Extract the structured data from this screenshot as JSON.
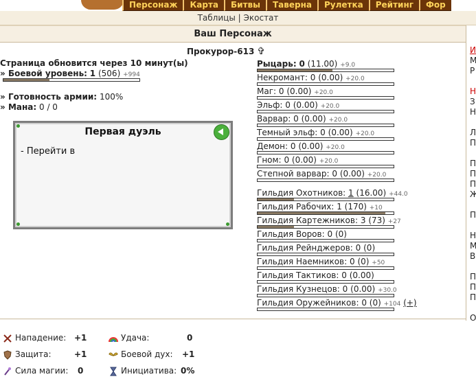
{
  "nav": {
    "tabs": [
      {
        "label": "Персонаж"
      },
      {
        "label": "Карта"
      },
      {
        "label": "Битвы"
      },
      {
        "label": "Таверна"
      },
      {
        "label": "Рулетка"
      },
      {
        "label": "Рейтинг"
      },
      {
        "label": "Фор"
      }
    ],
    "sublinks": {
      "tables": "Таблицы",
      "sep": "|",
      "ecostat": "Экостат"
    }
  },
  "section_title": "Ваш Персонаж",
  "character": {
    "name": "Прокурор-613",
    "cross": "✞",
    "refresh_notice": "Страница обновится через 10 минут(ы)",
    "combat_level_label": "Боевой уровень:",
    "combat_level_value": "1",
    "combat_level_extra": "(506)",
    "combat_level_plus": "+994",
    "combat_level_progress": 0.34,
    "army_ready_label": "Готовность армии:",
    "army_ready_value": "100%",
    "mana_label": "Мана:",
    "mana_value": "0 / 0"
  },
  "duel": {
    "title": "Первая дуэль",
    "text": "- Перейти в"
  },
  "factions": [
    {
      "label": "Рыцарь:",
      "value": "0",
      "extra": "(11.00)",
      "plus": "+9.0",
      "bold": true,
      "progress": 0.55
    },
    {
      "label": "Некромант:",
      "value": "0",
      "extra": "(0.00)",
      "plus": "+20.0",
      "progress": 0
    },
    {
      "label": "Маг:",
      "value": "0",
      "extra": "(0.00)",
      "plus": "+20.0",
      "progress": 0
    },
    {
      "label": "Эльф:",
      "value": "0",
      "extra": "(0.00)",
      "plus": "+20.0",
      "progress": 0
    },
    {
      "label": "Варвар:",
      "value": "0",
      "extra": "(0.00)",
      "plus": "+20.0",
      "progress": 0
    },
    {
      "label": "Темный эльф:",
      "value": "0",
      "extra": "(0.00)",
      "plus": "+20.0",
      "progress": 0
    },
    {
      "label": "Демон:",
      "value": "0",
      "extra": "(0.00)",
      "plus": "+20.0",
      "progress": 0
    },
    {
      "label": "Гном:",
      "value": "0",
      "extra": "(0.00)",
      "plus": "+20.0",
      "progress": 0
    },
    {
      "label": "Степной варвар:",
      "value": "0",
      "extra": "(0.00)",
      "plus": "+20.0",
      "progress": 0
    }
  ],
  "guilds": [
    {
      "label": "Гильдия Охотников:",
      "value": "1",
      "extra": "(16.00)",
      "plus": "+44.0",
      "underline": true,
      "progress": 0.27
    },
    {
      "label": "Гильдия Рабочих:",
      "value": "1",
      "extra": "(170)",
      "plus": "+10",
      "progress": 0.94
    },
    {
      "label": "Гильдия Картежников:",
      "value": "3",
      "extra": "(73)",
      "plus": "+27",
      "progress": 0.27
    },
    {
      "label": "Гильдия Воров:",
      "value": "0",
      "extra": "(0)",
      "plus": "",
      "progress": 0
    },
    {
      "label": "Гильдия Рейнджеров:",
      "value": "0",
      "extra": "(0)",
      "plus": "",
      "progress": 0
    },
    {
      "label": "Гильдия Наемников:",
      "value": "0",
      "extra": "(0)",
      "plus": "+50",
      "progress": 0
    },
    {
      "label": "Гильдия Тактиков:",
      "value": "0",
      "extra": "(0.00)",
      "plus": "",
      "progress": 0
    },
    {
      "label": "Гильдия Кузнецов:",
      "value": "0",
      "extra": "(0.00)",
      "plus": "+30.0",
      "progress": 0
    },
    {
      "label": "Гильдия Оружейников:",
      "value": "0",
      "extra": "(0)",
      "plus": "+104",
      "action": "(+)",
      "progress": 0
    }
  ],
  "right_col": [
    "И",
    "М",
    "Р",
    "",
    "Н",
    "З",
    "Н",
    "",
    "Л",
    "П",
    "",
    "П",
    "П",
    "П",
    "Ж",
    "",
    "П",
    "",
    "Н",
    "М",
    "В",
    "",
    "П",
    "П",
    "П",
    "",
    "О"
  ],
  "bottom_stats": {
    "attack": {
      "label": "Нападение:",
      "value": "+1"
    },
    "defense": {
      "label": "Защита:",
      "value": "+1"
    },
    "magic": {
      "label": "Сила магии:",
      "value": "0"
    },
    "luck": {
      "label": "Удача:",
      "value": "0"
    },
    "morale": {
      "label": "Боевой дух:",
      "value": "+1"
    },
    "initiative": {
      "label": "Инициатива:",
      "value": "0%"
    }
  },
  "colors": {
    "nav_bg": "#6b3409",
    "nav_text": "#ffd25a",
    "panel_bg": "#f6efe2",
    "bar_fill": "#8a7a64",
    "red": "#c00000"
  }
}
